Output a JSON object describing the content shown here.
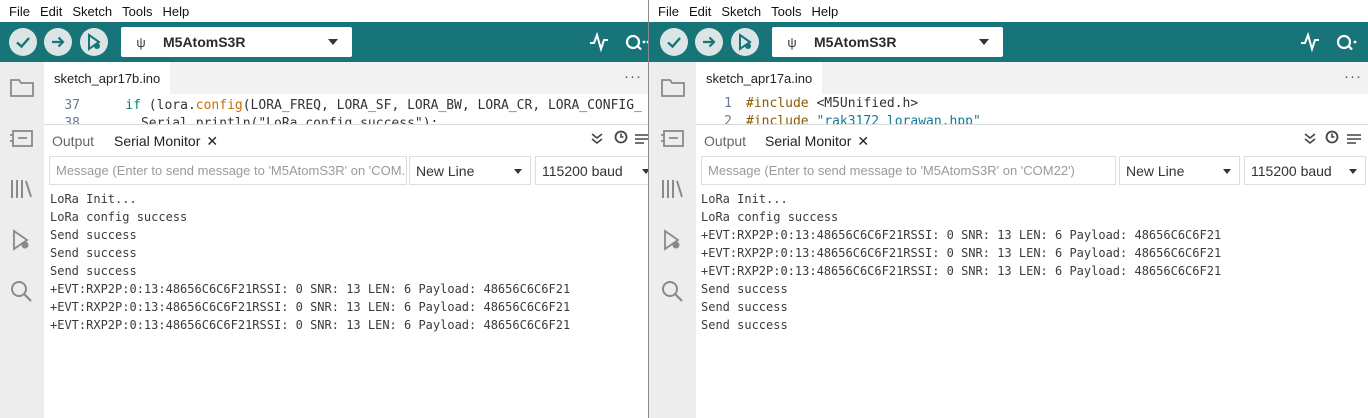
{
  "menu": [
    "File",
    "Edit",
    "Sketch",
    "Tools",
    "Help"
  ],
  "colors": {
    "toolbar": "#17757a",
    "toolbar_button": "#dbe5e5",
    "sidebar": "#ededed",
    "keyword": "#008080",
    "function": "#cc6d00",
    "string": "#0a7d96"
  },
  "left": {
    "board": "M5AtomS3R",
    "file_tab": "sketch_apr17b.ino",
    "tab_menu": "···",
    "code": [
      {
        "line": "37",
        "indent": "    ",
        "keyword": "if",
        "text1": " (",
        "obj": "lora",
        "dot": ".",
        "func": "config",
        "args": "(LORA_FREQ, LORA_SF, LORA_BW, LORA_CR, LORA_CONFIG_"
      },
      {
        "line": "38",
        "text": "      Serial.println(\"LoRa config success\");"
      }
    ],
    "panel": {
      "output_tab": "Output",
      "serial_tab": "Serial Monitor",
      "close": "✕"
    },
    "message_placeholder": "Message (Enter to send message to 'M5AtomS3R' on 'COM...",
    "line_ending": "New Line",
    "baud": "115200 baud",
    "serial_lines": [
      "LoRa Init...",
      "LoRa config success",
      "Send success",
      "Send success",
      "Send success",
      "+EVT:RXP2P:0:13:48656C6C6F21RSSI: 0 SNR: 13 LEN: 6 Payload: 48656C6C6F21",
      "+EVT:RXP2P:0:13:48656C6C6F21RSSI: 0 SNR: 13 LEN: 6 Payload: 48656C6C6F21",
      "+EVT:RXP2P:0:13:48656C6C6F21RSSI: 0 SNR: 13 LEN: 6 Payload: 48656C6C6F21"
    ]
  },
  "right": {
    "board": "M5AtomS3R",
    "file_tab": "sketch_apr17a.ino",
    "tab_menu": "···",
    "code": [
      {
        "line": "1",
        "directive": "#include",
        "header": " <M5Unified.h>"
      },
      {
        "line": "2",
        "directive": "#include",
        "header": " \"rak3172_lorawan.hpp\""
      }
    ],
    "panel": {
      "output_tab": "Output",
      "serial_tab": "Serial Monitor",
      "close": "✕"
    },
    "message_placeholder": "Message (Enter to send message to 'M5AtomS3R' on 'COM22')",
    "line_ending": "New Line",
    "baud": "115200 baud",
    "serial_lines": [
      "LoRa Init...",
      "LoRa config success",
      "+EVT:RXP2P:0:13:48656C6C6F21RSSI: 0 SNR: 13 LEN: 6 Payload: 48656C6C6F21",
      "+EVT:RXP2P:0:13:48656C6C6F21RSSI: 0 SNR: 13 LEN: 6 Payload: 48656C6C6F21",
      "+EVT:RXP2P:0:13:48656C6C6F21RSSI: 0 SNR: 13 LEN: 6 Payload: 48656C6C6F21",
      "Send success",
      "Send success",
      "Send success"
    ]
  }
}
